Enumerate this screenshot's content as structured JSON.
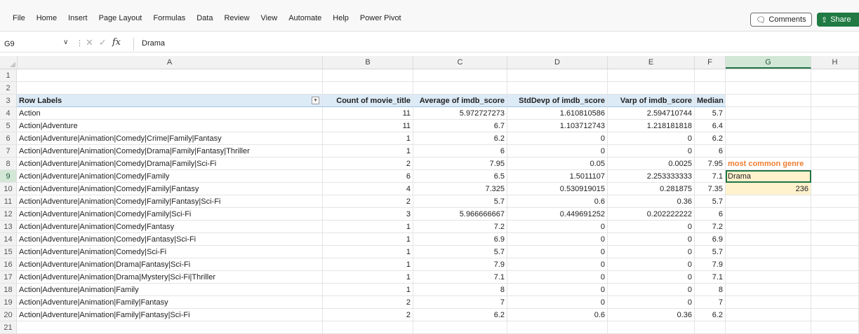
{
  "ribbon": {
    "tabs": [
      "File",
      "Home",
      "Insert",
      "Page Layout",
      "Formulas",
      "Data",
      "Review",
      "View",
      "Automate",
      "Help",
      "Power Pivot"
    ],
    "comments_label": "Comments",
    "share_label": "Share"
  },
  "formula_bar": {
    "name_box": "G9",
    "value": "Drama"
  },
  "columns": [
    "A",
    "B",
    "C",
    "D",
    "E",
    "F",
    "G",
    "H"
  ],
  "header": {
    "row_labels": "Row Labels",
    "count": "Count of movie_title",
    "average": "Average of imdb_score",
    "stdevp": "StdDevp of imdb_score",
    "varp": "Varp of imdb_score",
    "median": "Median"
  },
  "rows": [
    {
      "n": "4",
      "label": "Action",
      "count": "11",
      "avg": "5.972727273",
      "std": "1.610810586",
      "var": "2.594710744",
      "med": "5.7"
    },
    {
      "n": "5",
      "label": "Action|Adventure",
      "count": "11",
      "avg": "6.7",
      "std": "1.103712743",
      "var": "1.218181818",
      "med": "6.4"
    },
    {
      "n": "6",
      "label": "Action|Adventure|Animation|Comedy|Crime|Family|Fantasy",
      "count": "1",
      "avg": "6.2",
      "std": "0",
      "var": "0",
      "med": "6.2"
    },
    {
      "n": "7",
      "label": "Action|Adventure|Animation|Comedy|Drama|Family|Fantasy|Thriller",
      "count": "1",
      "avg": "6",
      "std": "0",
      "var": "0",
      "med": "6"
    },
    {
      "n": "8",
      "label": "Action|Adventure|Animation|Comedy|Drama|Family|Sci-Fi",
      "count": "2",
      "avg": "7.95",
      "std": "0.05",
      "var": "0.0025",
      "med": "7.95"
    },
    {
      "n": "9",
      "label": "Action|Adventure|Animation|Comedy|Family",
      "count": "6",
      "avg": "6.5",
      "std": "1.5011107",
      "var": "2.253333333",
      "med": "7.1"
    },
    {
      "n": "10",
      "label": "Action|Adventure|Animation|Comedy|Family|Fantasy",
      "count": "4",
      "avg": "7.325",
      "std": "0.530919015",
      "var": "0.281875",
      "med": "7.35"
    },
    {
      "n": "11",
      "label": "Action|Adventure|Animation|Comedy|Family|Fantasy|Sci-Fi",
      "count": "2",
      "avg": "5.7",
      "std": "0.6",
      "var": "0.36",
      "med": "5.7"
    },
    {
      "n": "12",
      "label": "Action|Adventure|Animation|Comedy|Family|Sci-Fi",
      "count": "3",
      "avg": "5.966666667",
      "std": "0.449691252",
      "var": "0.202222222",
      "med": "6"
    },
    {
      "n": "13",
      "label": "Action|Adventure|Animation|Comedy|Fantasy",
      "count": "1",
      "avg": "7.2",
      "std": "0",
      "var": "0",
      "med": "7.2"
    },
    {
      "n": "14",
      "label": "Action|Adventure|Animation|Comedy|Fantasy|Sci-Fi",
      "count": "1",
      "avg": "6.9",
      "std": "0",
      "var": "0",
      "med": "6.9"
    },
    {
      "n": "15",
      "label": "Action|Adventure|Animation|Comedy|Sci-Fi",
      "count": "1",
      "avg": "5.7",
      "std": "0",
      "var": "0",
      "med": "5.7"
    },
    {
      "n": "16",
      "label": "Action|Adventure|Animation|Drama|Fantasy|Sci-Fi",
      "count": "1",
      "avg": "7.9",
      "std": "0",
      "var": "0",
      "med": "7.9"
    },
    {
      "n": "17",
      "label": "Action|Adventure|Animation|Drama|Mystery|Sci-Fi|Thriller",
      "count": "1",
      "avg": "7.1",
      "std": "0",
      "var": "0",
      "med": "7.1"
    },
    {
      "n": "18",
      "label": "Action|Adventure|Animation|Family",
      "count": "1",
      "avg": "8",
      "std": "0",
      "var": "0",
      "med": "8"
    },
    {
      "n": "19",
      "label": "Action|Adventure|Animation|Family|Fantasy",
      "count": "2",
      "avg": "7",
      "std": "0",
      "var": "0",
      "med": "7"
    },
    {
      "n": "20",
      "label": "Action|Adventure|Animation|Family|Fantasy|Sci-Fi",
      "count": "2",
      "avg": "6.2",
      "std": "0.6",
      "var": "0.36",
      "med": "6.2"
    }
  ],
  "side": {
    "most_common_label": "most common genre",
    "genre": "Drama",
    "genre_count": "236"
  },
  "colors": {
    "accent_green": "#217346",
    "header_blue": "#ddebf7",
    "orange": "#ed7d31",
    "highlight_yellow": "#fff2cc"
  }
}
